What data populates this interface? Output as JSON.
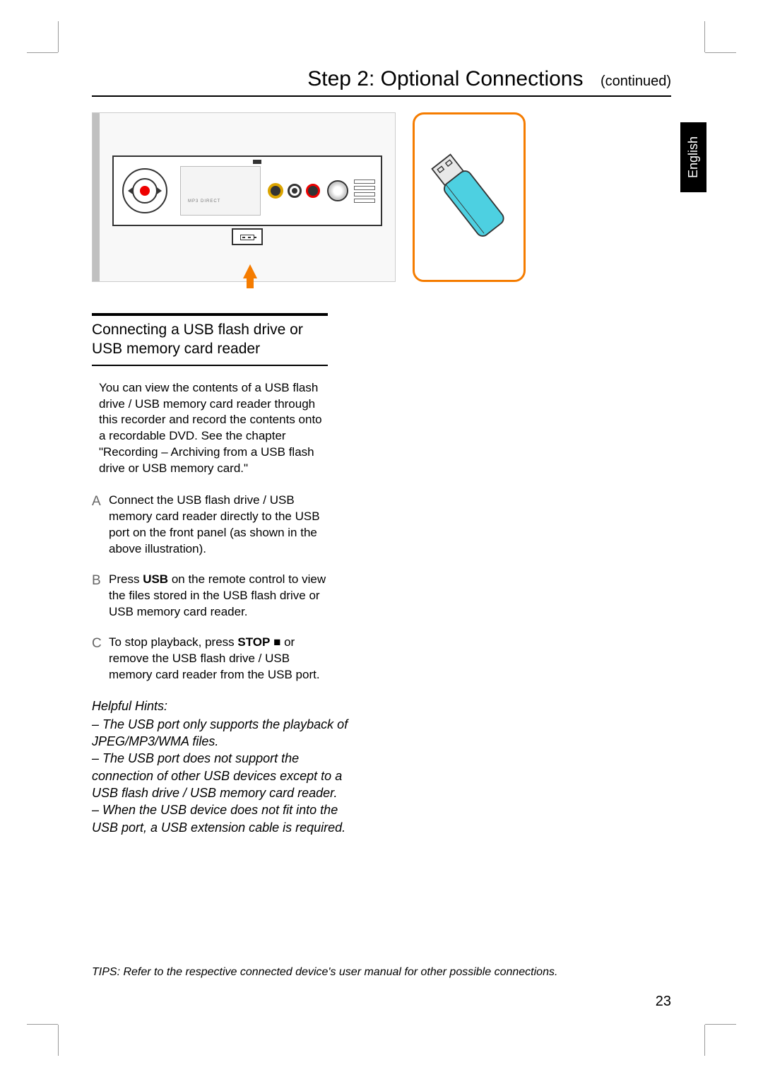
{
  "header": {
    "title": "Step 2: Optional Connections",
    "continued": "(continued)"
  },
  "language_tab": "English",
  "figure": {
    "mid_label": "MP3 DIRECT"
  },
  "section": {
    "title": "Connecting a USB ﬂash drive or USB memory card reader",
    "intro": "You can view the contents of a USB flash drive / USB memory card reader through this recorder and record the contents onto a recordable DVD. See the chapter \"Recording – Archiving from a USB flash drive or USB memory card.\"",
    "steps": [
      {
        "letter": "A",
        "text": "Connect the USB flash drive / USB memory card reader directly to the USB port on the front panel (as shown in the above illustration)."
      },
      {
        "letter": "B",
        "prefix": "Press ",
        "cmd": "USB",
        "suffix": " on the remote control to view the files stored in the USB flash drive or USB memory card reader."
      },
      {
        "letter": "C",
        "prefix": "To stop playback, press ",
        "cmd": "STOP",
        "glyph": " ■ ",
        "suffix": "or remove the USB flash drive / USB memory card reader from the USB port."
      }
    ],
    "hints_title": "Helpful Hints:",
    "hints": [
      "– The USB port only supports the playback of JPEG/MP3/WMA ﬁles.",
      "– The USB port does not support the connection of other USB devices except to a USB ﬂash drive / USB memory card reader.",
      "– When the USB device does not ﬁt into the USB port, a USB extension cable is required."
    ]
  },
  "tips": "TIPS:  Refer to the respective connected device's user manual for other possible connections.",
  "page_number": "23"
}
